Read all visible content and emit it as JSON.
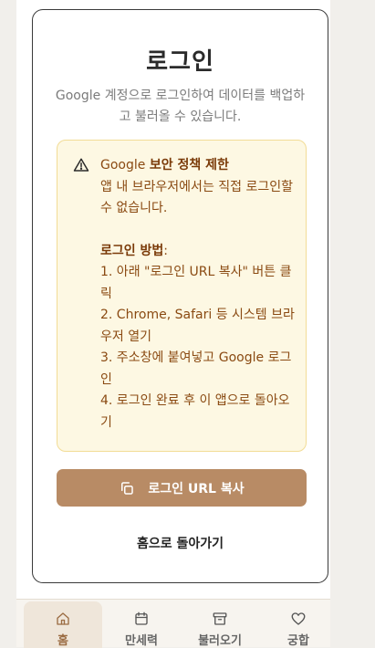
{
  "login": {
    "title": "로그인",
    "subtitle": "Google 계정으로 로그인하여 데이터를 백업하고 불러올 수 있습니다."
  },
  "warning": {
    "prefix": "Google ",
    "strong": "보안 정책 제한",
    "line2": "앱 내 브라우저에서는 직접 로그인할 수 없습니다.",
    "method_title": "로그인 방법",
    "method_colon": ":",
    "steps": [
      "1. 아래 \"로그인 URL 복사\" 버튼 클릭",
      "2. Chrome, Safari 등 시스템 브라우저 열기",
      "3. 주소창에 붙여넣고 Google 로그인",
      "4. 로그인 완료 후 이 앱으로 돌아오기"
    ]
  },
  "buttons": {
    "copy_url": "로그인 URL 복사",
    "go_home": "홈으로 돌아가기"
  },
  "nav": {
    "items": [
      {
        "label": "홈",
        "icon": "home-icon",
        "active": true
      },
      {
        "label": "만세력",
        "icon": "calendar-icon",
        "active": false
      },
      {
        "label": "불러오기",
        "icon": "archive-icon",
        "active": false
      },
      {
        "label": "궁합",
        "icon": "heart-icon",
        "active": false
      }
    ]
  },
  "colors": {
    "accent": "#b88b65",
    "warning_bg": "#fdf8e3",
    "warning_border": "#f2dc96",
    "warning_text": "#8a4a12",
    "top_strip": "#e8743b"
  }
}
